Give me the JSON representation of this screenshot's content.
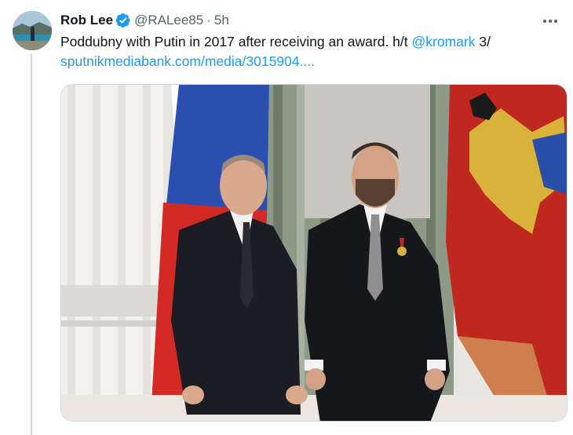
{
  "tweet": {
    "display_name": "Rob Lee",
    "handle": "@RALee85",
    "separator": "·",
    "time": "5h",
    "text_part1": "Poddubny with Putin in 2017 after receiving an award. h/t ",
    "mention": "@kromark",
    "text_part2": " 3/",
    "url": "sputnikmediabank.com/media/3015904....",
    "verified_icon": "verified-badge-icon",
    "more_icon": "more-options-icon"
  },
  "colors": {
    "link": "#1d9bf0",
    "secondary_text": "#536471",
    "verified": "#1d9bf0",
    "thread_line": "#cfd9de"
  }
}
